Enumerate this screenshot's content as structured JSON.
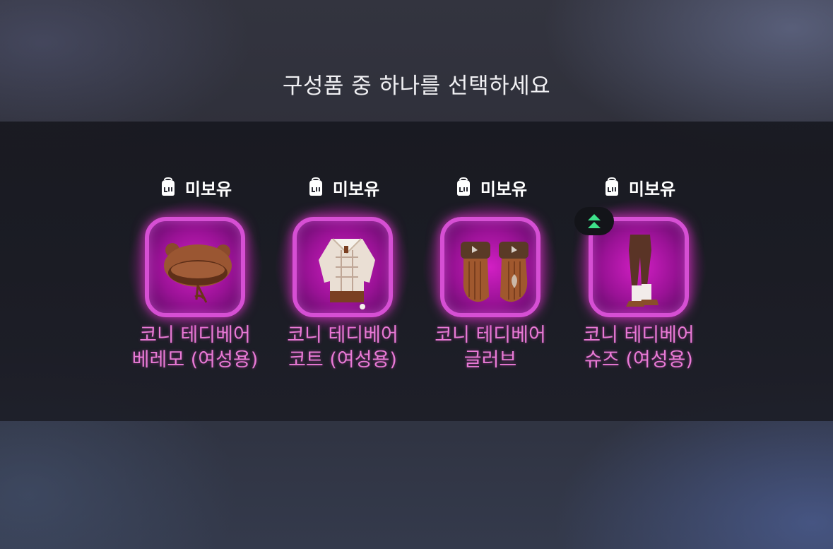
{
  "title": "구성품 중 하나를 선택하세요",
  "accent_color": "#d64fd4",
  "name_color": "#e97ad6",
  "items": [
    {
      "status": "미보유",
      "status_icon": "bag-icon",
      "name": "코니 테디베어\n베레모 (여성용)",
      "item_icon": "beret-icon",
      "upgrade": false
    },
    {
      "status": "미보유",
      "status_icon": "bag-icon",
      "name": "코니 테디베어\n코트 (여성용)",
      "item_icon": "coat-icon",
      "upgrade": false
    },
    {
      "status": "미보유",
      "status_icon": "bag-icon",
      "name": "코니 테디베어\n글러브",
      "item_icon": "gloves-icon",
      "upgrade": false
    },
    {
      "status": "미보유",
      "status_icon": "bag-icon",
      "name": "코니 테디베어\n슈즈 (여성용)",
      "item_icon": "shoes-icon",
      "upgrade": true,
      "upgrade_icon": "double-chevron-up-icon"
    }
  ]
}
